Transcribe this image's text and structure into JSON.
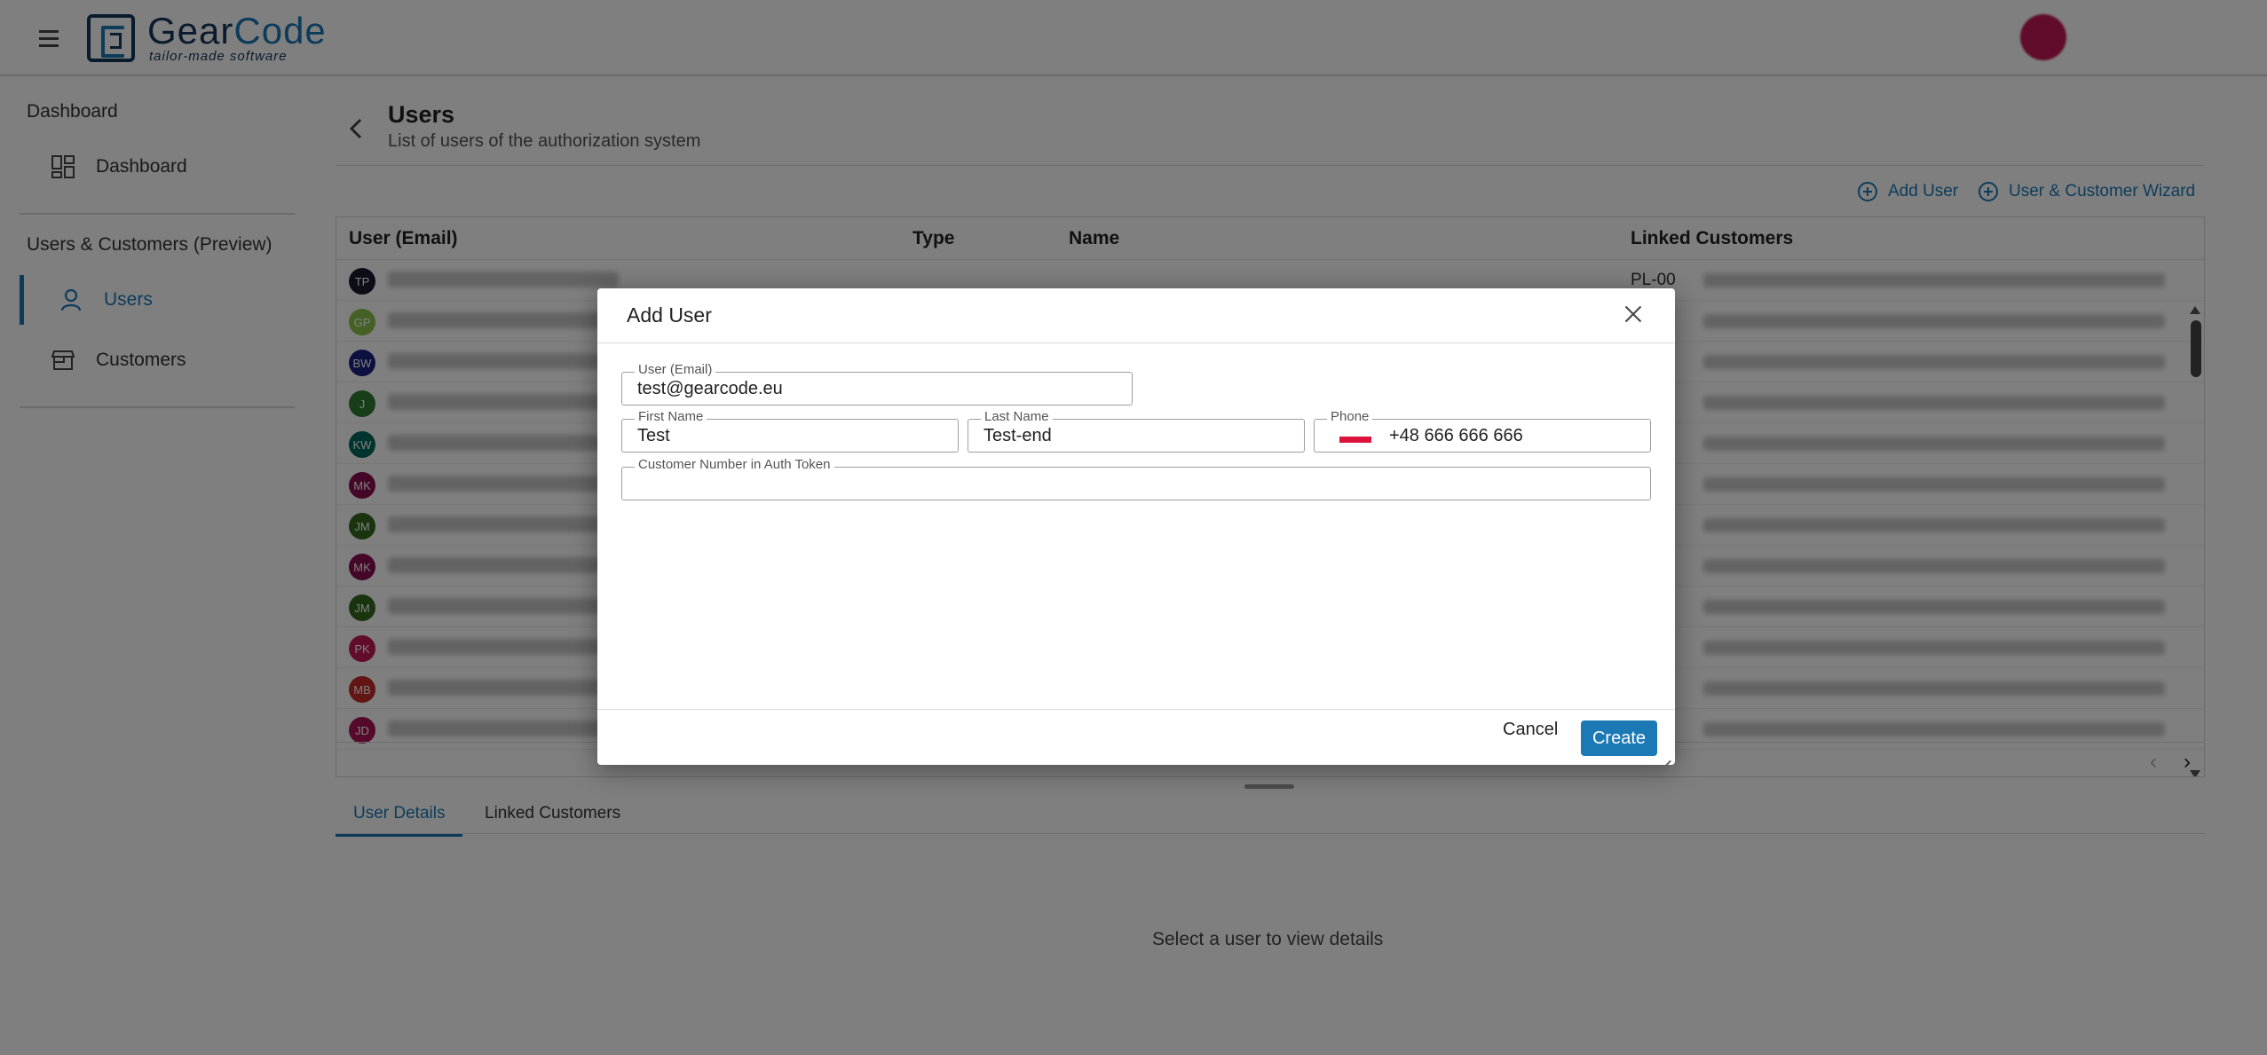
{
  "header": {
    "logo_name_a": "Gear",
    "logo_name_b": "Code",
    "logo_tagline": "tailor-made software"
  },
  "sidebar": {
    "section1": "Dashboard",
    "dashboard_item": "Dashboard",
    "section2": "Users & Customers (Preview)",
    "users_item": "Users",
    "customers_item": "Customers"
  },
  "page": {
    "title": "Users",
    "subtitle": "List of users of the authorization system",
    "add_user": "Add User",
    "wizard": "User & Customer Wizard"
  },
  "grid": {
    "columns": [
      "User (Email)",
      "Type",
      "Name",
      "Linked Customers"
    ],
    "rows": [
      {
        "initials": "TP",
        "color": "#1a1a2e",
        "linked": "PL-00"
      },
      {
        "initials": "GP",
        "color": "#8bc34a",
        "linked": ""
      },
      {
        "initials": "BW",
        "color": "#1a237e",
        "linked": ""
      },
      {
        "initials": "J",
        "color": "#2e7d32",
        "linked": ""
      },
      {
        "initials": "KW",
        "color": "#00695c",
        "linked": ""
      },
      {
        "initials": "MK",
        "color": "#880e4f",
        "linked": ""
      },
      {
        "initials": "JM",
        "color": "#33691e",
        "linked": ""
      },
      {
        "initials": "MK",
        "color": "#880e4f",
        "linked": ""
      },
      {
        "initials": "JM",
        "color": "#33691e",
        "linked": ""
      },
      {
        "initials": "PK",
        "color": "#c2185b",
        "linked": ""
      },
      {
        "initials": "MB",
        "color": "#c62828",
        "linked": ""
      },
      {
        "initials": "JD",
        "color": "#ad1457",
        "linked": ""
      }
    ]
  },
  "details": {
    "tab_user_details": "User Details",
    "tab_linked_customers": "Linked Customers",
    "empty_message": "Select a user to view details"
  },
  "dialog": {
    "title": "Add User",
    "email_label": "User (Email)",
    "email_value": "test@gearcode.eu",
    "first_name_label": "First Name",
    "first_name_value": "Test",
    "last_name_label": "Last Name",
    "last_name_value": "Test-end",
    "phone_label": "Phone",
    "phone_value": "+48 666 666 666",
    "customer_number_label": "Customer Number in Auth Token",
    "customer_number_value": "",
    "cancel": "Cancel",
    "create": "Create"
  },
  "colors": {
    "accent": "#1b79b5",
    "brand_dark": "#14365a",
    "overlay": "rgba(0,0,0,0.5)"
  }
}
